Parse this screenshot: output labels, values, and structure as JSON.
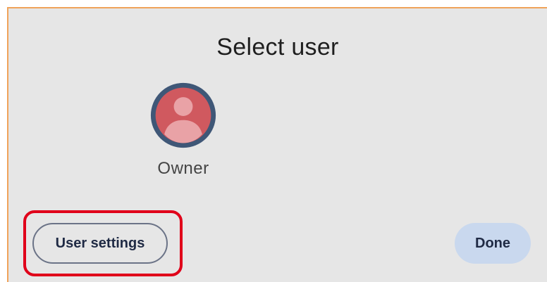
{
  "dialog": {
    "title": "Select user"
  },
  "users": [
    {
      "name": "Owner",
      "avatar_icon": "person-avatar-icon",
      "avatar_ring_color": "#3f5777",
      "avatar_fill_color": "#d0595f",
      "avatar_figure_color": "#e9a2a6"
    }
  ],
  "buttons": {
    "user_settings_label": "User settings",
    "done_label": "Done"
  },
  "annotation": {
    "highlight_color": "#e0001a"
  }
}
